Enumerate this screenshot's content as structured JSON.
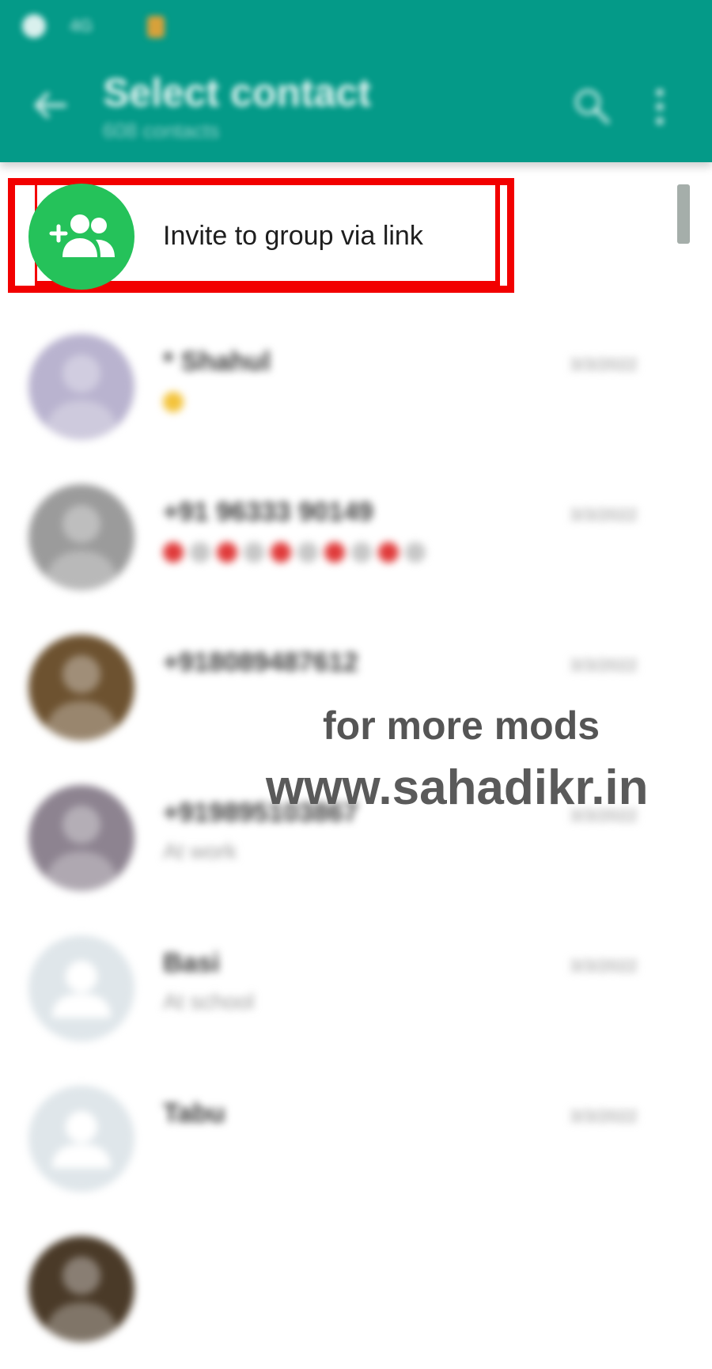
{
  "colors": {
    "header": "#049a88",
    "accent": "#25c25a",
    "highlight": "#f20000"
  },
  "status_bar": {
    "app_icon": "whatsapp-icon",
    "text": "4G",
    "lock_icon": "lock-icon"
  },
  "header": {
    "back_icon": "arrow-left-icon",
    "title": "Select contact",
    "subtitle": "608 contacts",
    "search_icon": "search-icon",
    "more_icon": "more-vertical-icon"
  },
  "invite": {
    "icon": "add-group-icon",
    "label": "Invite to group via link"
  },
  "contacts": [
    {
      "name": "* Shahul",
      "status": "",
      "date": "3/3/2022",
      "avatar_color": "#b9b3cf",
      "status_emoji": "yellow"
    },
    {
      "name": "+91 96333 90149",
      "status": "",
      "date": "3/3/2022",
      "avatar_color": "#9b9b9b",
      "status_emoji": "red-grey"
    },
    {
      "name": "+918089487612",
      "status": "",
      "date": "3/3/2022",
      "avatar_color": "#6d5230"
    },
    {
      "name": "+919895103867",
      "status": "At work",
      "date": "3/3/2022",
      "avatar_color": "#8d8390"
    },
    {
      "name": "Basi",
      "status": "At school",
      "date": "3/3/2022",
      "avatar_color": "#dfe6ea"
    },
    {
      "name": "Tabu",
      "status": "",
      "date": "3/3/2022",
      "avatar_color": "#dfe6ea"
    },
    {
      "name": "",
      "status": "",
      "date": "",
      "avatar_color": "#4a3a28"
    }
  ],
  "watermark": {
    "line1": "for more mods",
    "line2": "www.sahadikr.in"
  }
}
